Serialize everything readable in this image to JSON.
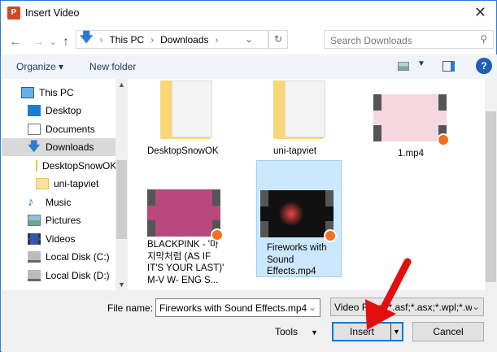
{
  "window": {
    "title": "Insert Video",
    "app_icon": "P"
  },
  "address": {
    "segments": [
      "This PC",
      "Downloads"
    ]
  },
  "search": {
    "placeholder": "Search Downloads"
  },
  "toolbar": {
    "organize": "Organize",
    "new_folder": "New folder"
  },
  "sidebar": {
    "items": [
      {
        "label": "This PC"
      },
      {
        "label": "Desktop"
      },
      {
        "label": "Documents"
      },
      {
        "label": "Downloads"
      },
      {
        "label": "DesktopSnowOK"
      },
      {
        "label": "uni-tapviet"
      },
      {
        "label": "Music"
      },
      {
        "label": "Pictures"
      },
      {
        "label": "Videos"
      },
      {
        "label": "Local Disk (C:)"
      },
      {
        "label": "Local Disk (D:)"
      }
    ]
  },
  "files": [
    {
      "name": "DesktopSnowOK",
      "type": "folder"
    },
    {
      "name": "uni-tapviet",
      "type": "folder"
    },
    {
      "name": "1.mp4",
      "type": "video"
    },
    {
      "name": "BLACKPINK - '마지막처럼 (AS IF IT'S YOUR LAST)' M-V W- ENG S...",
      "type": "video"
    },
    {
      "name": "Fireworks with Sound Effects.mp4",
      "type": "video",
      "selected": true
    }
  ],
  "footer": {
    "file_name_label": "File name:",
    "file_name_value": "Fireworks with Sound Effects.mp4",
    "filter": "Video Files (*.asf;*.asx;*.wpl;*.w",
    "tools": "Tools",
    "insert": "Insert",
    "cancel": "Cancel"
  }
}
